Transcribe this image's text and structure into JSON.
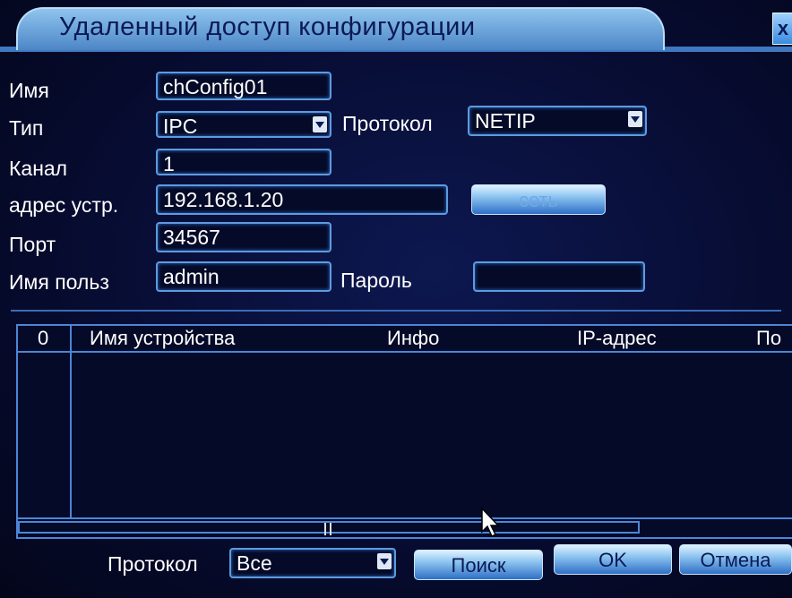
{
  "window": {
    "title": "Удаленный доступ конфигурации",
    "close_glyph": "x",
    "accent_color": "#4d86c6",
    "background_color": "#070c32"
  },
  "form": {
    "name_label": "Имя",
    "name_value": "chConfig01",
    "type_label": "Тип",
    "type_value": "IPC",
    "protocol_label": "Протокол",
    "protocol_value": "NETIP",
    "channel_label": "Канал",
    "channel_value": "1",
    "address_label": "адрес устр.",
    "address_value": "192.168.1.20",
    "network_button_label": "сеть",
    "port_label": "Порт",
    "port_value": "34567",
    "username_label": "Имя польз",
    "username_value": "admin",
    "password_label": "Пароль",
    "password_value": ""
  },
  "device_table": {
    "columns": [
      "0",
      "Имя устройства",
      "Инфо",
      "IP-адрес",
      "По"
    ],
    "rows": []
  },
  "footer": {
    "protocol_label": "Протокол",
    "protocol_value": "Все",
    "search_button": "Поиск",
    "ok_button": "OK",
    "cancel_button": "Отмена"
  }
}
